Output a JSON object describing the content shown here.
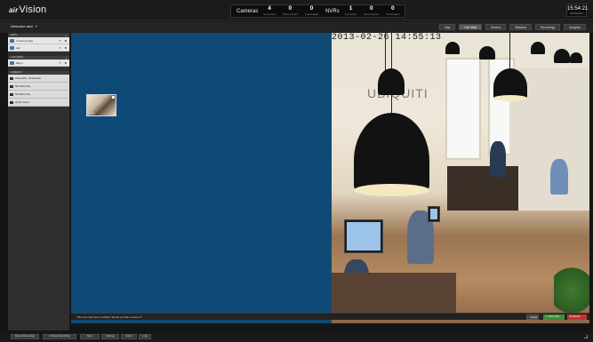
{
  "app": {
    "logo_prefix": "air",
    "logo_name": "Vision"
  },
  "stats": {
    "cameras_label": "Cameras",
    "cameras": [
      {
        "value": "4",
        "sub": "Connected"
      },
      {
        "value": "0",
        "sub": "Disconnected"
      },
      {
        "value": "0",
        "sub": "Unmanaged"
      }
    ],
    "nvrs_label": "NVRs",
    "nvrs": [
      {
        "value": "1",
        "sub": "Connected"
      },
      {
        "value": "0",
        "sub": "Disconnected"
      },
      {
        "value": "0",
        "sub": "Unmanaged"
      }
    ]
  },
  "clock": {
    "time": "15:54:21",
    "date": "02/26/2013"
  },
  "user": {
    "welcome": "Welcome airvi"
  },
  "tabs": [
    {
      "label": "Map"
    },
    {
      "label": "Live View",
      "active": true
    },
    {
      "label": "Devices"
    },
    {
      "label": "Statistics"
    },
    {
      "label": "Recordings"
    },
    {
      "label": "Analytics"
    }
  ],
  "sidebar": {
    "maps_head": "MAPS",
    "maps": [
      {
        "label": "3 Camera View"
      },
      {
        "label": "Lab"
      }
    ],
    "views_head": "LIVE VIEWS",
    "views": [
      {
        "label": "Map 1"
      }
    ],
    "cameras_head": "CAMERAS",
    "cameras": [
      {
        "label": "airCamMini - Refrigerator"
      },
      {
        "label": "NE Office Area"
      },
      {
        "label": "SE Office Area"
      },
      {
        "label": "airCam Dome"
      }
    ]
  },
  "thumbnail": {
    "label": "airCam"
  },
  "camera_feed": {
    "timestamp": "2013-02-26 14:55:13",
    "wall_text": "UBIQUITI"
  },
  "message": {
    "text": "This view has been modified. Would you like to save it?",
    "cancel": "Cancel",
    "save": "✔ Save View",
    "discard": "✖ Discard"
  },
  "bottom_tabs": [
    "Recent Recordings",
    "Archived Recordings",
    "Alerts",
    "Settings",
    "Admin",
    "Logs"
  ]
}
